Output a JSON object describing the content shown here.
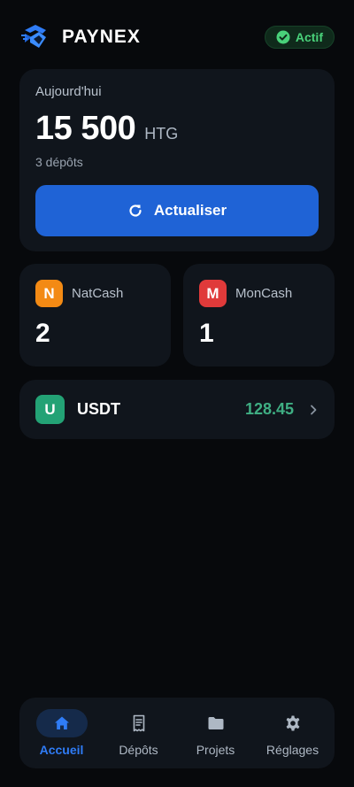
{
  "header": {
    "brand_name": "PAYNEX",
    "status_label": "Actif",
    "logo_icon": "paynex-logo-icon"
  },
  "today": {
    "label": "Aujourd'hui",
    "amount": "15 500",
    "currency": "HTG",
    "deposit_count": "3 dépôts",
    "refresh_label": "Actualiser"
  },
  "methods": [
    {
      "letter": "N",
      "name": "NatCash",
      "count": "2",
      "color": "#f38a14"
    },
    {
      "letter": "M",
      "name": "MonCash",
      "count": "1",
      "color": "#e03a3a"
    }
  ],
  "usdt": {
    "letter": "U",
    "name": "USDT",
    "value": "128.45",
    "badge_color": "#23a275",
    "value_color": "#3fae83"
  },
  "nav": {
    "items": [
      {
        "label": "Accueil",
        "icon": "home-icon",
        "active": true
      },
      {
        "label": "Dépôts",
        "icon": "receipt-icon",
        "active": false
      },
      {
        "label": "Projets",
        "icon": "folder-icon",
        "active": false
      },
      {
        "label": "Réglages",
        "icon": "gear-icon",
        "active": false
      }
    ]
  },
  "colors": {
    "background": "#07090c",
    "card": "#10151c",
    "accent": "#1f63d6",
    "nav_active": "#2f7cf6",
    "status_green": "#49d17a"
  }
}
